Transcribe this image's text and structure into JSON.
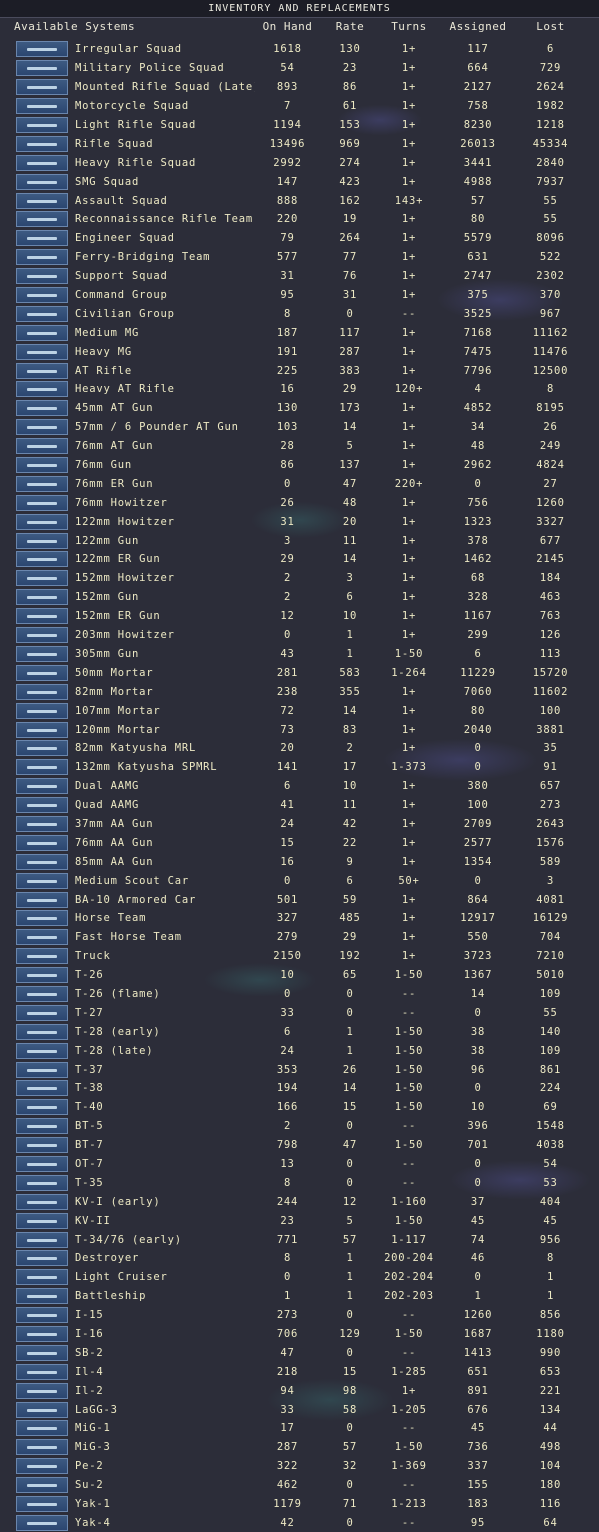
{
  "title": "INVENTORY AND REPLACEMENTS",
  "columns": {
    "systems": "Available Systems",
    "on_hand": "On Hand",
    "rate": "Rate",
    "turns": "Turns",
    "assigned": "Assigned",
    "lost": "Lost"
  },
  "rows": [
    {
      "name": "Irregular Squad",
      "on_hand": "1618",
      "rate": "130",
      "turns": "1+",
      "assigned": "117",
      "lost": "6",
      "icon": "rifle-icon"
    },
    {
      "name": "Military Police Squad",
      "on_hand": "54",
      "rate": "23",
      "turns": "1+",
      "assigned": "664",
      "lost": "729",
      "icon": "rifle-icon"
    },
    {
      "name": "Mounted Rifle Squad (Late)",
      "on_hand": "893",
      "rate": "86",
      "turns": "1+",
      "assigned": "2127",
      "lost": "2624",
      "icon": "rifle-icon"
    },
    {
      "name": "Motorcycle Squad",
      "on_hand": "7",
      "rate": "61",
      "turns": "1+",
      "assigned": "758",
      "lost": "1982",
      "icon": "motorcycle-icon"
    },
    {
      "name": "Light Rifle Squad",
      "on_hand": "1194",
      "rate": "153",
      "turns": "1+",
      "assigned": "8230",
      "lost": "1218",
      "icon": "rifle-icon"
    },
    {
      "name": "Rifle Squad",
      "on_hand": "13496",
      "rate": "969",
      "turns": "1+",
      "assigned": "26013",
      "lost": "45334",
      "icon": "rifle-icon"
    },
    {
      "name": "Heavy Rifle Squad",
      "on_hand": "2992",
      "rate": "274",
      "turns": "1+",
      "assigned": "3441",
      "lost": "2840",
      "icon": "rifle-icon"
    },
    {
      "name": "SMG Squad",
      "on_hand": "147",
      "rate": "423",
      "turns": "1+",
      "assigned": "4988",
      "lost": "7937",
      "icon": "smg-icon"
    },
    {
      "name": "Assault Squad",
      "on_hand": "888",
      "rate": "162",
      "turns": "143+",
      "assigned": "57",
      "lost": "55",
      "icon": "smg-icon"
    },
    {
      "name": "Reconnaissance Rifle Team",
      "on_hand": "220",
      "rate": "19",
      "turns": "1+",
      "assigned": "80",
      "lost": "55",
      "icon": "rifle-icon"
    },
    {
      "name": "Engineer Squad",
      "on_hand": "79",
      "rate": "264",
      "turns": "1+",
      "assigned": "5579",
      "lost": "8096",
      "icon": "rifle-icon"
    },
    {
      "name": "Ferry-Bridging Team",
      "on_hand": "577",
      "rate": "77",
      "turns": "1+",
      "assigned": "631",
      "lost": "522",
      "icon": "rifle-icon"
    },
    {
      "name": "Support Squad",
      "on_hand": "31",
      "rate": "76",
      "turns": "1+",
      "assigned": "2747",
      "lost": "2302",
      "icon": "soldier-icon"
    },
    {
      "name": "Command Group",
      "on_hand": "95",
      "rate": "31",
      "turns": "1+",
      "assigned": "375",
      "lost": "370",
      "icon": "soldier-icon"
    },
    {
      "name": "Civilian Group",
      "on_hand": "8",
      "rate": "0",
      "turns": "--",
      "assigned": "3525",
      "lost": "967",
      "icon": "soldier-icon"
    },
    {
      "name": "Medium MG",
      "on_hand": "187",
      "rate": "117",
      "turns": "1+",
      "assigned": "7168",
      "lost": "11162",
      "icon": "machine-gun-icon"
    },
    {
      "name": "Heavy MG",
      "on_hand": "191",
      "rate": "287",
      "turns": "1+",
      "assigned": "7475",
      "lost": "11476",
      "icon": "machine-gun-icon"
    },
    {
      "name": "AT Rifle",
      "on_hand": "225",
      "rate": "383",
      "turns": "1+",
      "assigned": "7796",
      "lost": "12500",
      "icon": "rifle-icon"
    },
    {
      "name": "Heavy AT Rifle",
      "on_hand": "16",
      "rate": "29",
      "turns": "120+",
      "assigned": "4",
      "lost": "8",
      "icon": "rifle-icon"
    },
    {
      "name": "45mm AT Gun",
      "on_hand": "130",
      "rate": "173",
      "turns": "1+",
      "assigned": "4852",
      "lost": "8195",
      "icon": "gun-icon"
    },
    {
      "name": "57mm / 6 Pounder AT Gun",
      "on_hand": "103",
      "rate": "14",
      "turns": "1+",
      "assigned": "34",
      "lost": "26",
      "icon": "gun-icon"
    },
    {
      "name": "76mm AT Gun",
      "on_hand": "28",
      "rate": "5",
      "turns": "1+",
      "assigned": "48",
      "lost": "249",
      "icon": "gun-icon"
    },
    {
      "name": "76mm Gun",
      "on_hand": "86",
      "rate": "137",
      "turns": "1+",
      "assigned": "2962",
      "lost": "4824",
      "icon": "gun-icon"
    },
    {
      "name": "76mm ER Gun",
      "on_hand": "0",
      "rate": "47",
      "turns": "220+",
      "assigned": "0",
      "lost": "27",
      "icon": "gun-icon"
    },
    {
      "name": "76mm Howitzer",
      "on_hand": "26",
      "rate": "48",
      "turns": "1+",
      "assigned": "756",
      "lost": "1260",
      "icon": "howitzer-icon"
    },
    {
      "name": "122mm Howitzer",
      "on_hand": "31",
      "rate": "20",
      "turns": "1+",
      "assigned": "1323",
      "lost": "3327",
      "icon": "howitzer-icon"
    },
    {
      "name": "122mm Gun",
      "on_hand": "3",
      "rate": "11",
      "turns": "1+",
      "assigned": "378",
      "lost": "677",
      "icon": "gun-icon"
    },
    {
      "name": "122mm ER Gun",
      "on_hand": "29",
      "rate": "14",
      "turns": "1+",
      "assigned": "1462",
      "lost": "2145",
      "icon": "gun-icon"
    },
    {
      "name": "152mm Howitzer",
      "on_hand": "2",
      "rate": "3",
      "turns": "1+",
      "assigned": "68",
      "lost": "184",
      "icon": "howitzer-icon"
    },
    {
      "name": "152mm Gun",
      "on_hand": "2",
      "rate": "6",
      "turns": "1+",
      "assigned": "328",
      "lost": "463",
      "icon": "gun-icon"
    },
    {
      "name": "152mm ER Gun",
      "on_hand": "12",
      "rate": "10",
      "turns": "1+",
      "assigned": "1167",
      "lost": "763",
      "icon": "gun-icon"
    },
    {
      "name": "203mm Howitzer",
      "on_hand": "0",
      "rate": "1",
      "turns": "1+",
      "assigned": "299",
      "lost": "126",
      "icon": "howitzer-icon"
    },
    {
      "name": "305mm Gun",
      "on_hand": "43",
      "rate": "1",
      "turns": "1-50",
      "assigned": "6",
      "lost": "113",
      "icon": "gun-icon"
    },
    {
      "name": "50mm Mortar",
      "on_hand": "281",
      "rate": "583",
      "turns": "1-264",
      "assigned": "11229",
      "lost": "15720",
      "icon": "mortar-icon"
    },
    {
      "name": "82mm Mortar",
      "on_hand": "238",
      "rate": "355",
      "turns": "1+",
      "assigned": "7060",
      "lost": "11602",
      "icon": "mortar-icon"
    },
    {
      "name": "107mm Mortar",
      "on_hand": "72",
      "rate": "14",
      "turns": "1+",
      "assigned": "80",
      "lost": "100",
      "icon": "mortar-icon"
    },
    {
      "name": "120mm Mortar",
      "on_hand": "73",
      "rate": "83",
      "turns": "1+",
      "assigned": "2040",
      "lost": "3881",
      "icon": "mortar-icon"
    },
    {
      "name": "82mm Katyusha MRL",
      "on_hand": "20",
      "rate": "2",
      "turns": "1+",
      "assigned": "0",
      "lost": "35",
      "icon": "rocket-launcher-icon"
    },
    {
      "name": "132mm Katyusha SPMRL",
      "on_hand": "141",
      "rate": "17",
      "turns": "1-373",
      "assigned": "0",
      "lost": "91",
      "icon": "rocket-launcher-icon"
    },
    {
      "name": "Dual AAMG",
      "on_hand": "6",
      "rate": "10",
      "turns": "1+",
      "assigned": "380",
      "lost": "657",
      "icon": "aa-gun-icon"
    },
    {
      "name": "Quad AAMG",
      "on_hand": "41",
      "rate": "11",
      "turns": "1+",
      "assigned": "100",
      "lost": "273",
      "icon": "aa-gun-icon"
    },
    {
      "name": "37mm AA Gun",
      "on_hand": "24",
      "rate": "42",
      "turns": "1+",
      "assigned": "2709",
      "lost": "2643",
      "icon": "aa-gun-icon"
    },
    {
      "name": "76mm AA Gun",
      "on_hand": "15",
      "rate": "22",
      "turns": "1+",
      "assigned": "2577",
      "lost": "1576",
      "icon": "aa-gun-icon"
    },
    {
      "name": "85mm AA Gun",
      "on_hand": "16",
      "rate": "9",
      "turns": "1+",
      "assigned": "1354",
      "lost": "589",
      "icon": "aa-gun-icon"
    },
    {
      "name": "Medium Scout Car",
      "on_hand": "0",
      "rate": "6",
      "turns": "50+",
      "assigned": "0",
      "lost": "3",
      "icon": "car-icon"
    },
    {
      "name": "BA-10 Armored Car",
      "on_hand": "501",
      "rate": "59",
      "turns": "1+",
      "assigned": "864",
      "lost": "4081",
      "icon": "car-icon"
    },
    {
      "name": "Horse Team",
      "on_hand": "327",
      "rate": "485",
      "turns": "1+",
      "assigned": "12917",
      "lost": "16129",
      "icon": "horse-icon"
    },
    {
      "name": "Fast Horse Team",
      "on_hand": "279",
      "rate": "29",
      "turns": "1+",
      "assigned": "550",
      "lost": "704",
      "icon": "horse-icon"
    },
    {
      "name": "Truck",
      "on_hand": "2150",
      "rate": "192",
      "turns": "1+",
      "assigned": "3723",
      "lost": "7210",
      "icon": "truck-icon"
    },
    {
      "name": "T-26",
      "on_hand": "10",
      "rate": "65",
      "turns": "1-50",
      "assigned": "1367",
      "lost": "5010",
      "icon": "tank-icon"
    },
    {
      "name": "T-26 (flame)",
      "on_hand": "0",
      "rate": "0",
      "turns": "--",
      "assigned": "14",
      "lost": "109",
      "icon": "tank-icon"
    },
    {
      "name": "T-27",
      "on_hand": "33",
      "rate": "0",
      "turns": "--",
      "assigned": "0",
      "lost": "55",
      "icon": "tank-icon"
    },
    {
      "name": "T-28 (early)",
      "on_hand": "6",
      "rate": "1",
      "turns": "1-50",
      "assigned": "38",
      "lost": "140",
      "icon": "tank-icon"
    },
    {
      "name": "T-28 (late)",
      "on_hand": "24",
      "rate": "1",
      "turns": "1-50",
      "assigned": "38",
      "lost": "109",
      "icon": "tank-icon"
    },
    {
      "name": "T-37",
      "on_hand": "353",
      "rate": "26",
      "turns": "1-50",
      "assigned": "96",
      "lost": "861",
      "icon": "tank-icon"
    },
    {
      "name": "T-38",
      "on_hand": "194",
      "rate": "14",
      "turns": "1-50",
      "assigned": "0",
      "lost": "224",
      "icon": "tank-icon"
    },
    {
      "name": "T-40",
      "on_hand": "166",
      "rate": "15",
      "turns": "1-50",
      "assigned": "10",
      "lost": "69",
      "icon": "tank-icon"
    },
    {
      "name": "BT-5",
      "on_hand": "2",
      "rate": "0",
      "turns": "--",
      "assigned": "396",
      "lost": "1548",
      "icon": "tank-icon"
    },
    {
      "name": "BT-7",
      "on_hand": "798",
      "rate": "47",
      "turns": "1-50",
      "assigned": "701",
      "lost": "4038",
      "icon": "tank-icon"
    },
    {
      "name": "OT-7",
      "on_hand": "13",
      "rate": "0",
      "turns": "--",
      "assigned": "0",
      "lost": "54",
      "icon": "tank-icon"
    },
    {
      "name": "T-35",
      "on_hand": "8",
      "rate": "0",
      "turns": "--",
      "assigned": "0",
      "lost": "53",
      "icon": "tank-icon"
    },
    {
      "name": "KV-I (early)",
      "on_hand": "244",
      "rate": "12",
      "turns": "1-160",
      "assigned": "37",
      "lost": "404",
      "icon": "tank-icon"
    },
    {
      "name": "KV-II",
      "on_hand": "23",
      "rate": "5",
      "turns": "1-50",
      "assigned": "45",
      "lost": "45",
      "icon": "tank-icon"
    },
    {
      "name": "T-34/76 (early)",
      "on_hand": "771",
      "rate": "57",
      "turns": "1-117",
      "assigned": "74",
      "lost": "956",
      "icon": "tank-icon"
    },
    {
      "name": "Destroyer",
      "on_hand": "8",
      "rate": "1",
      "turns": "200-204",
      "assigned": "46",
      "lost": "8",
      "icon": "ship-icon"
    },
    {
      "name": "Light Cruiser",
      "on_hand": "0",
      "rate": "1",
      "turns": "202-204",
      "assigned": "0",
      "lost": "1",
      "icon": "ship-icon"
    },
    {
      "name": "Battleship",
      "on_hand": "1",
      "rate": "1",
      "turns": "202-203",
      "assigned": "1",
      "lost": "1",
      "icon": "ship-icon"
    },
    {
      "name": "I-15",
      "on_hand": "273",
      "rate": "0",
      "turns": "--",
      "assigned": "1260",
      "lost": "856",
      "icon": "aircraft-icon"
    },
    {
      "name": "I-16",
      "on_hand": "706",
      "rate": "129",
      "turns": "1-50",
      "assigned": "1687",
      "lost": "1180",
      "icon": "aircraft-icon"
    },
    {
      "name": "SB-2",
      "on_hand": "47",
      "rate": "0",
      "turns": "--",
      "assigned": "1413",
      "lost": "990",
      "icon": "aircraft-icon"
    },
    {
      "name": "Il-4",
      "on_hand": "218",
      "rate": "15",
      "turns": "1-285",
      "assigned": "651",
      "lost": "653",
      "icon": "aircraft-icon"
    },
    {
      "name": "Il-2",
      "on_hand": "94",
      "rate": "98",
      "turns": "1+",
      "assigned": "891",
      "lost": "221",
      "icon": "aircraft-icon"
    },
    {
      "name": "LaGG-3",
      "on_hand": "33",
      "rate": "58",
      "turns": "1-205",
      "assigned": "676",
      "lost": "134",
      "icon": "aircraft-icon"
    },
    {
      "name": "MiG-1",
      "on_hand": "17",
      "rate": "0",
      "turns": "--",
      "assigned": "45",
      "lost": "44",
      "icon": "aircraft-icon"
    },
    {
      "name": "MiG-3",
      "on_hand": "287",
      "rate": "57",
      "turns": "1-50",
      "assigned": "736",
      "lost": "498",
      "icon": "aircraft-icon"
    },
    {
      "name": "Pe-2",
      "on_hand": "322",
      "rate": "32",
      "turns": "1-369",
      "assigned": "337",
      "lost": "104",
      "icon": "aircraft-icon"
    },
    {
      "name": "Su-2",
      "on_hand": "462",
      "rate": "0",
      "turns": "--",
      "assigned": "155",
      "lost": "180",
      "icon": "aircraft-icon"
    },
    {
      "name": "Yak-1",
      "on_hand": "1179",
      "rate": "71",
      "turns": "1-213",
      "assigned": "183",
      "lost": "116",
      "icon": "aircraft-icon"
    },
    {
      "name": "Yak-4",
      "on_hand": "42",
      "rate": "0",
      "turns": "--",
      "assigned": "95",
      "lost": "64",
      "icon": "aircraft-icon"
    }
  ]
}
